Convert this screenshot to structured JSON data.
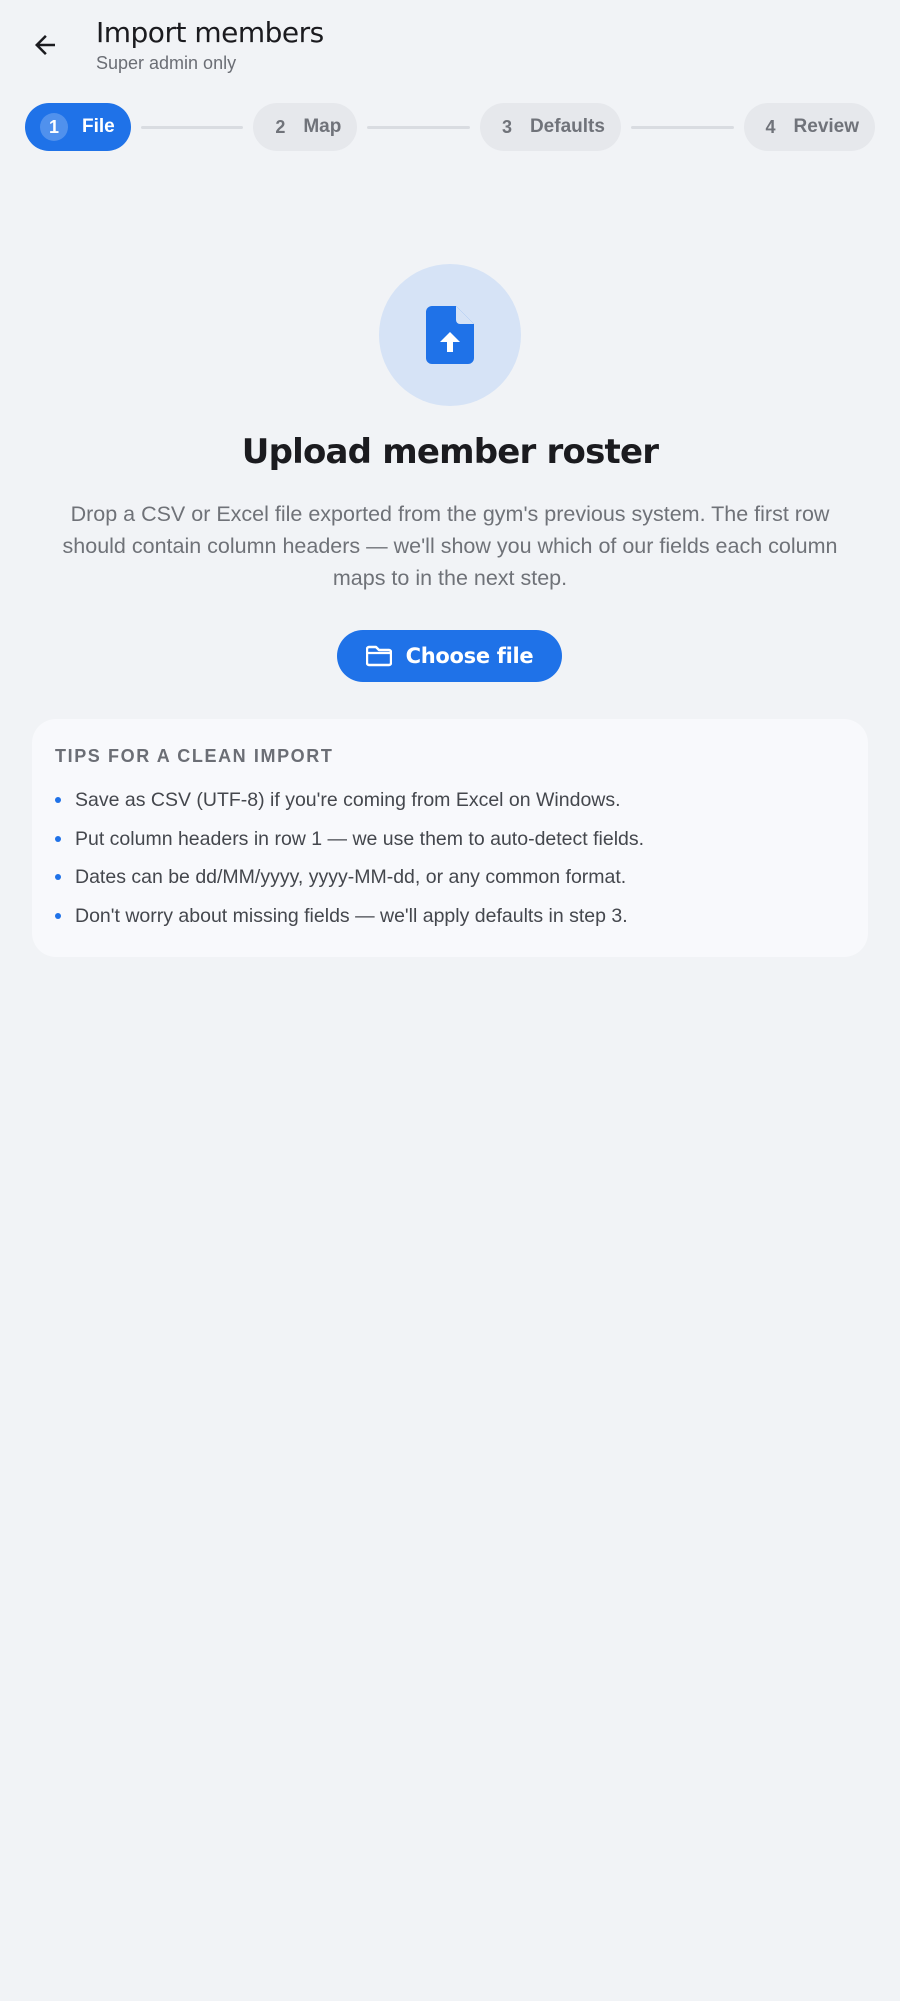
{
  "header": {
    "title": "Import members",
    "subtitle": "Super admin only",
    "back_icon": "arrow-left-icon"
  },
  "stepper": {
    "steps": [
      {
        "number": "1",
        "label": "File",
        "active": true
      },
      {
        "number": "2",
        "label": "Map",
        "active": false
      },
      {
        "number": "3",
        "label": "Defaults",
        "active": false
      },
      {
        "number": "4",
        "label": "Review",
        "active": false
      }
    ]
  },
  "upload": {
    "icon": "file-upload-icon",
    "title": "Upload member roster",
    "description": "Drop a CSV or Excel file exported from the gym's previous system. The first row should contain column headers — we'll show you which of our fields each column maps to in the next step.",
    "button_label": "Choose file",
    "button_icon": "folder-icon"
  },
  "tips": {
    "heading": "TIPS FOR A CLEAN IMPORT",
    "items": [
      "Save as CSV (UTF-8) if you're coming from Excel on Windows.",
      "Put column headers in row 1 — we use them to auto-detect fields.",
      "Dates can be dd/MM/yyyy, yyyy-MM-dd, or any common format.",
      "Don't worry about missing fields — we'll apply defaults in step 3."
    ]
  },
  "colors": {
    "accent": "#1f72e8",
    "background": "#f1f3f6",
    "icon_circle": "#d6e3f6"
  }
}
